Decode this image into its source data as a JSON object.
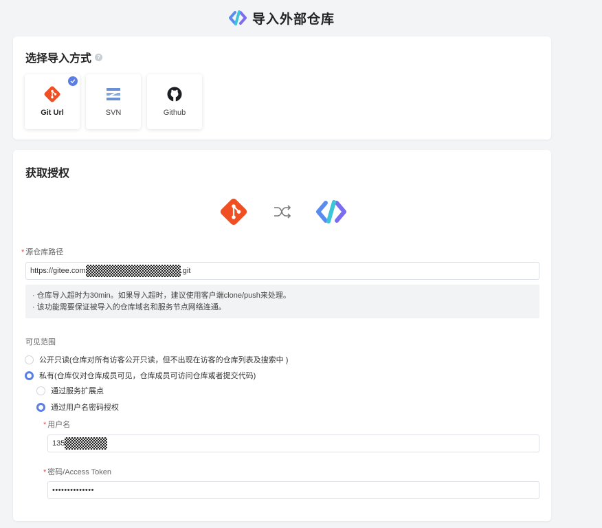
{
  "page": {
    "title": "导入外部仓库"
  },
  "import_method": {
    "title": "选择导入方式",
    "options": [
      {
        "label": "Git Url",
        "icon": "git-icon",
        "selected": true
      },
      {
        "label": "SVN",
        "icon": "svn-icon",
        "selected": false
      },
      {
        "label": "Github",
        "icon": "github-icon",
        "selected": false
      }
    ]
  },
  "auth": {
    "title": "获取授权",
    "source_path": {
      "label": "源仓库路径",
      "value_prefix": "https://gitee.com",
      "value_suffix": ".git"
    },
    "notes": [
      "· 仓库导入超时为30min。如果导入超时，建议使用客户端clone/push来处理。",
      "· 该功能需要保证被导入的仓库域名和服务节点网络连通。"
    ],
    "visibility": {
      "label": "可见范围",
      "public": "公开只读(仓库对所有访客公开只读，但不出现在访客的仓库列表及搜索中 )",
      "private": "私有(仓库仅对仓库成员可见，仓库成员可访问仓库或者提交代码)",
      "selected": "private"
    },
    "auth_method": {
      "extension": "通过服务扩展点",
      "password": "通过用户名密码授权",
      "selected": "password"
    },
    "username": {
      "label": "用户名",
      "value_prefix": "135"
    },
    "password": {
      "label": "密码/Access Token",
      "value": "••••••••••••••"
    }
  },
  "colors": {
    "git": "#f04e23",
    "accent": "#5b7ee5",
    "required": "#e5484d"
  }
}
